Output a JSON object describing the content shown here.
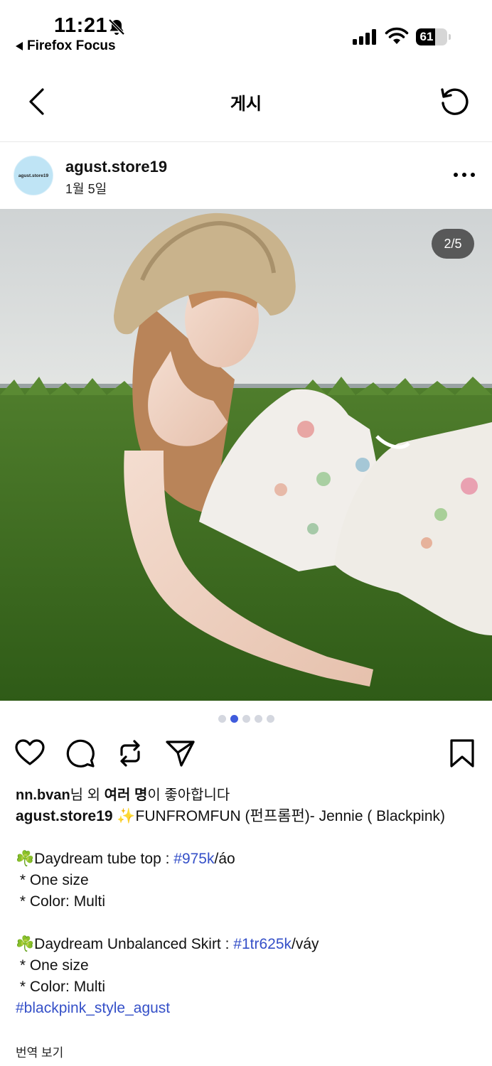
{
  "status_bar": {
    "time": "11:21",
    "back_app": "Firefox Focus",
    "battery": "61",
    "battery_level": 0.61
  },
  "nav": {
    "title": "게시"
  },
  "post": {
    "avatar_text": "agust.store19",
    "username": "agust.store19",
    "date": "1월 5일",
    "counter": "2/5",
    "image_count": 5,
    "active_image_index": 1
  },
  "likes": {
    "user": "nn.bvan",
    "mid": "님 외 ",
    "bold": "여러 명",
    "tail": "이 좋아합니다"
  },
  "caption": {
    "username": "agust.store19",
    "intro": " ✨FUNFROMFUN (펀프롬펀)- Jennie ( Blackpink)",
    "item1_prefix": "☘️Daydream tube top : ",
    "item1_tag": "#975k",
    "item1_suffix": "/áo",
    "item1_size": " * One size",
    "item1_color": " * Color: Multi",
    "item2_prefix": "☘️Daydream Unbalanced Skirt : ",
    "item2_tag": "#1tr625k",
    "item2_suffix": "/váy",
    "item2_size": " * One size",
    "item2_color": " * Color: Multi",
    "hashtag": "#blackpink_style_agust"
  },
  "translate_label": "번역 보기",
  "icons": {
    "back": "chevron-left-icon",
    "refresh": "refresh-icon",
    "more": "more-horizontal-icon",
    "like": "heart-icon",
    "comment": "comment-icon",
    "repost": "repost-icon",
    "share": "send-icon",
    "save": "bookmark-icon"
  },
  "colors": {
    "link": "#3550c8",
    "active_dot": "#3f5bdc"
  }
}
